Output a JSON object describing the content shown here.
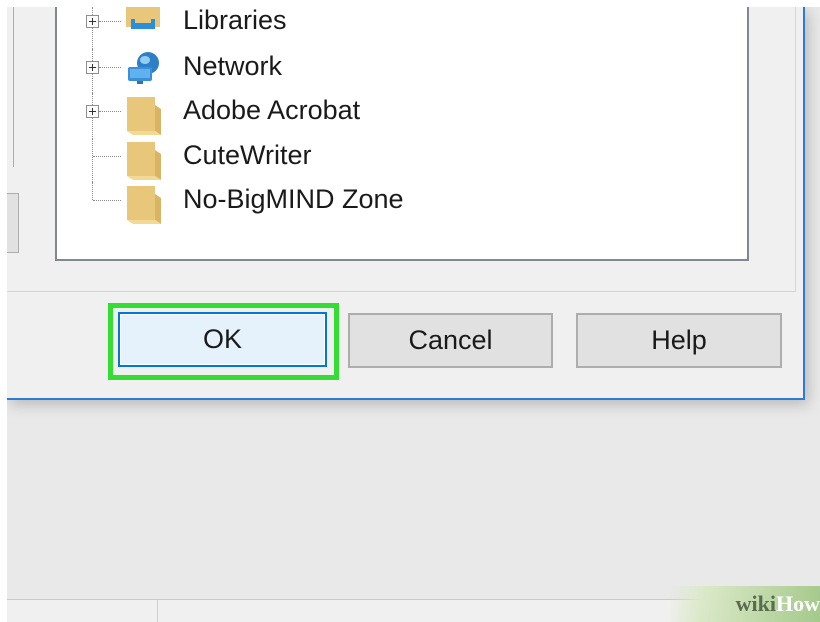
{
  "tree": {
    "items": [
      {
        "label": "Libraries",
        "icon": "libraries-icon",
        "expandable": true
      },
      {
        "label": "Network",
        "icon": "network-icon",
        "expandable": true
      },
      {
        "label": "Adobe Acrobat",
        "icon": "folder-icon",
        "expandable": true
      },
      {
        "label": "CuteWriter",
        "icon": "folder-icon",
        "expandable": false
      },
      {
        "label": "No-BigMIND Zone",
        "icon": "folder-icon",
        "expandable": false
      }
    ]
  },
  "buttons": {
    "ok": "OK",
    "cancel": "Cancel",
    "help": "Help"
  },
  "highlight_color": "#33dd33",
  "focus_color": "#0078d7",
  "folder_color": "#e8c77a",
  "watermark": {
    "wiki": "wiki",
    "how": "How"
  }
}
